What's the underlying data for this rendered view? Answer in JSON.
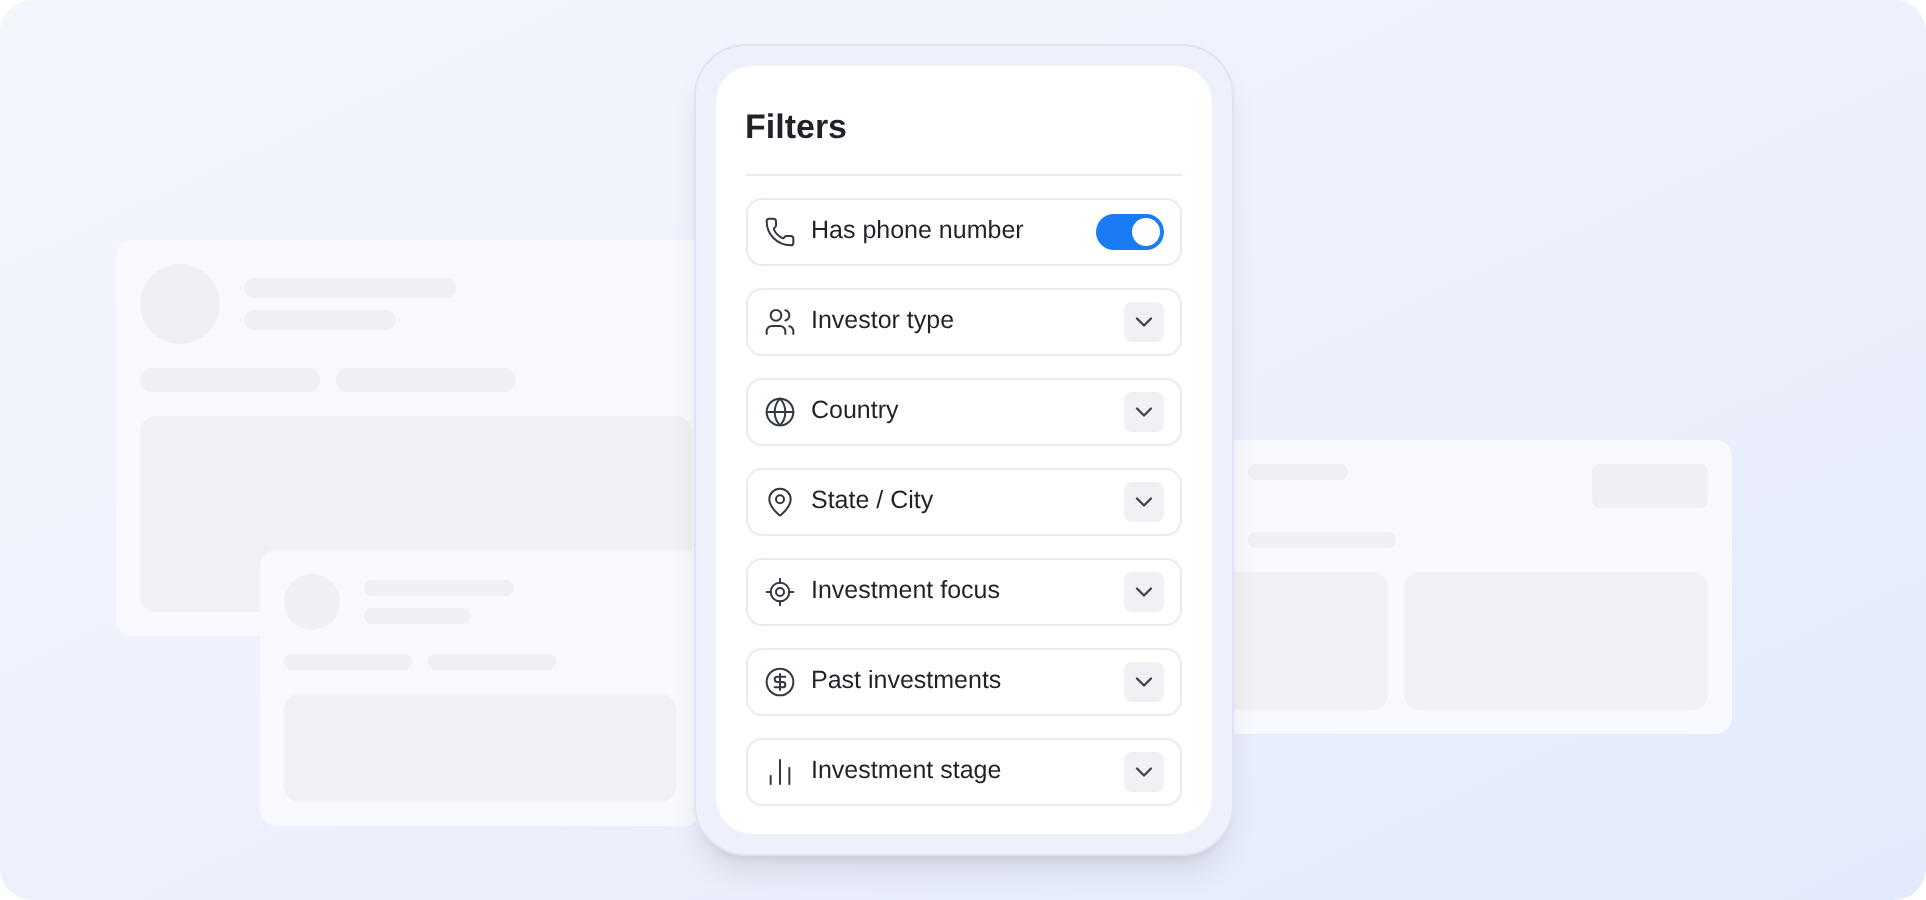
{
  "panel": {
    "title": "Filters"
  },
  "filters": [
    {
      "kind": "toggle",
      "label": "Has phone number",
      "on": true
    },
    {
      "kind": "dropdown",
      "label": "Investor type",
      "expanded": false
    },
    {
      "kind": "dropdown",
      "label": "Country",
      "expanded": false
    },
    {
      "kind": "dropdown",
      "label": "State / City",
      "expanded": false
    },
    {
      "kind": "dropdown",
      "label": "Investment focus",
      "expanded": false
    },
    {
      "kind": "dropdown",
      "label": "Past investments",
      "expanded": false
    },
    {
      "kind": "dropdown",
      "label": "Investment stage",
      "expanded": false
    }
  ]
}
